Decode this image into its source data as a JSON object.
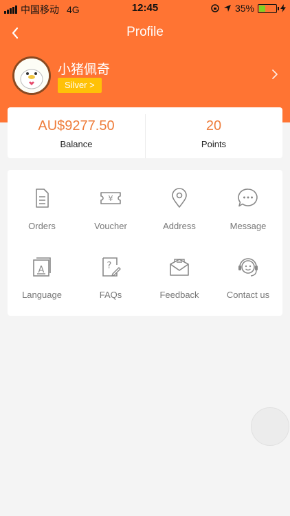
{
  "status_bar": {
    "carrier": "中国移动",
    "network": "4G",
    "time": "12:45",
    "battery_percent": "35%",
    "battery_level": 0.35
  },
  "navbar": {
    "title": "Profile",
    "back_icon": "chevron-left-icon"
  },
  "user": {
    "name": "小猪佩奇",
    "level_label": "Silver >",
    "arrow_icon": "chevron-right-icon"
  },
  "stats": {
    "balance_value": "AU$9277.50",
    "balance_label": "Balance",
    "points_value": "20",
    "points_label": "Points"
  },
  "menu": {
    "items": [
      {
        "label": "Orders",
        "icon": "document-icon"
      },
      {
        "label": "Voucher",
        "icon": "ticket-icon"
      },
      {
        "label": "Address",
        "icon": "location-pin-icon"
      },
      {
        "label": "Message",
        "icon": "chat-icon"
      },
      {
        "label": "Language",
        "icon": "language-icon"
      },
      {
        "label": "FAQs",
        "icon": "faq-icon"
      },
      {
        "label": "Feedback",
        "icon": "envelope-icon"
      },
      {
        "label": "Contact us",
        "icon": "headset-icon"
      }
    ]
  },
  "colors": {
    "brand": "#ff7433",
    "accent_text": "#ee7c3a",
    "badge": "#ffc107"
  }
}
